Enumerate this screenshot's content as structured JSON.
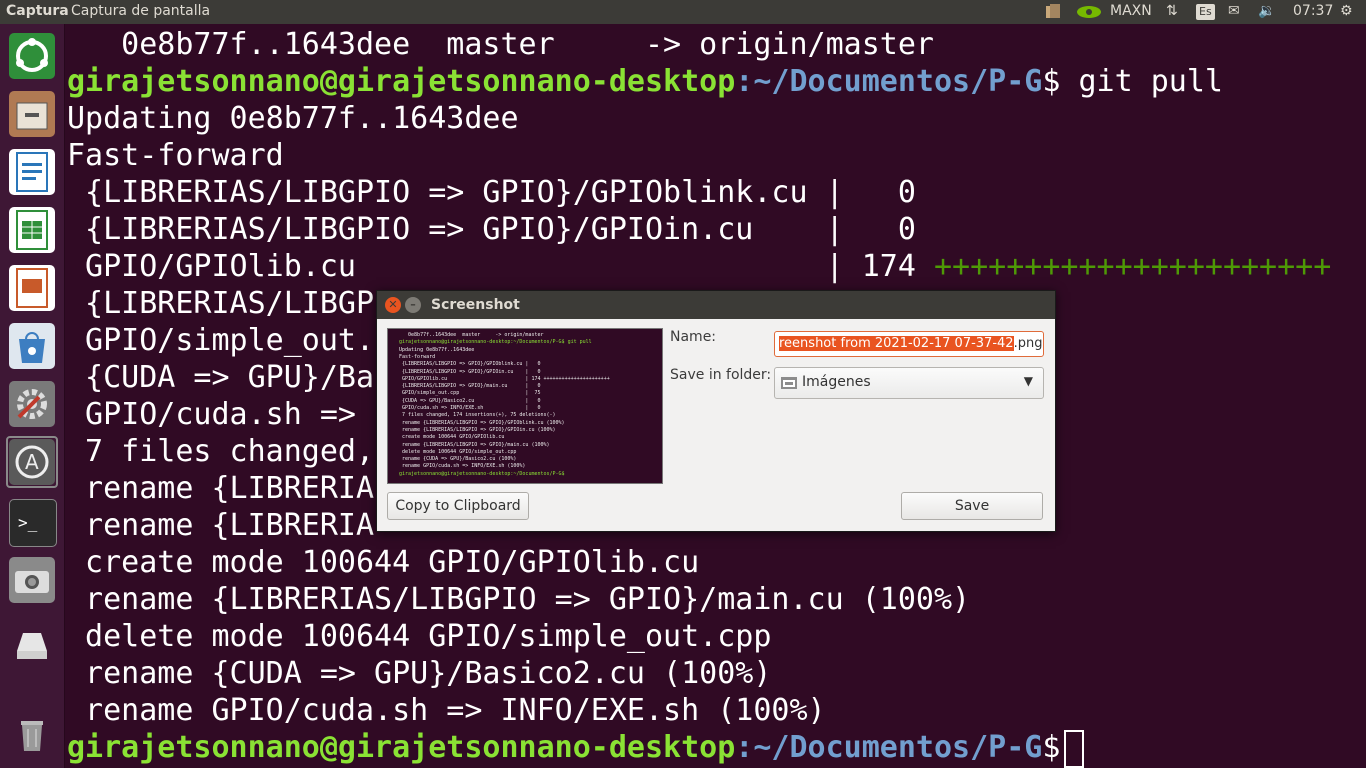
{
  "topbar": {
    "app_name": "Captura",
    "window_title": "Captura de pantalla",
    "nvidia_label": "MAXN",
    "keyboard_layout": "Es",
    "clock": "07:37",
    "icons": [
      "network-icon",
      "nvidia-icon",
      "transfer-icon",
      "keyboard-icon",
      "mail-icon",
      "volume-icon",
      "power-icon"
    ]
  },
  "launcher": {
    "items": [
      {
        "name": "ubuntu-dash-icon",
        "color": "#2f8f3a"
      },
      {
        "name": "files-icon",
        "color": "#b07a53"
      },
      {
        "name": "writer-icon",
        "color": "#2a76b9"
      },
      {
        "name": "calc-icon",
        "color": "#2f8f3a"
      },
      {
        "name": "impress-icon",
        "color": "#c85a2a"
      },
      {
        "name": "software-center-icon",
        "color": "#3d7ec1"
      },
      {
        "name": "system-settings-icon",
        "color": "#7a7a7a"
      },
      {
        "name": "software-updater-icon",
        "color": "#5a5a5a"
      },
      {
        "name": "terminal-icon",
        "color": "#2a2a2a"
      },
      {
        "name": "screenshot-icon",
        "color": "#8a8a8a"
      },
      {
        "name": "drive-icon",
        "color": "#cfcfcf"
      },
      {
        "name": "trash-icon",
        "color": "#9a9a9a"
      }
    ]
  },
  "terminal": {
    "prompt_user": "girajetsonnano@girajetsonnano-desktop",
    "prompt_path": ":~/Documentos/P-G",
    "command": "$ git pull",
    "prompt_end": "$",
    "line_top": "   0e8b77f..1643dee  master     -> origin/master",
    "line_updating": "Updating 0e8b77f..1643dee",
    "line_ff": "Fast-forward",
    "line_blink": " {LIBRERIAS/LIBGPIO => GPIO}/GPIOblink.cu |   0",
    "line_in": " {LIBRERIAS/LIBGPIO => GPIO}/GPIOin.cu    |   0",
    "line_lib": " GPIO/GPIOlib.cu                          | 174 ",
    "line_lib_plus": "++++++++++++++++++++++",
    "line_main_frag": " {LIBRERIAS/LIBGP",
    "line_simple_frag": " GPIO/simple_out.",
    "line_basico_frag": " {CUDA => GPU}/Ba",
    "line_cuda_frag": " GPIO/cuda.sh => ",
    "line_changed_frag": " 7 files changed,",
    "line_rename1_frag": " rename {LIBRERIA",
    "line_rename2_frag": " rename {LIBRERIA",
    "line_create": " create mode 100644 GPIO/GPIOlib.cu",
    "line_rename_main": " rename {LIBRERIAS/LIBGPIO => GPIO}/main.cu (100%)",
    "line_delete": " delete mode 100644 GPIO/simple_out.cpp",
    "line_rename_basico": " rename {CUDA => GPU}/Basico2.cu (100%)",
    "line_rename_cuda": " rename GPIO/cuda.sh => INFO/EXE.sh (100%)"
  },
  "dialog": {
    "title": "Screenshot",
    "name_label": "Name:",
    "name_value_selected": "reenshot from 2021-02-17 07-37-42",
    "name_value_ext": ".png",
    "folder_label": "Save in folder:",
    "folder_value": "Imágenes",
    "copy_button": "Copy to Clipboard",
    "save_button": "Save",
    "thumbnail_lines": [
      "   0e8b77f..1643dee  master     -> origin/master",
      "girajetsonnano@girajetsonnano-desktop:~/Documentos/P-G$ git pull",
      "Updating 0e8b77f..1643dee",
      "Fast-forward",
      " {LIBRERIAS/LIBGPIO => GPIO}/GPIOblink.cu |   0",
      " {LIBRERIAS/LIBGPIO => GPIO}/GPIOin.cu    |   0",
      " GPIO/GPIOlib.cu                          | 174 ++++++++++++++++++++++",
      " {LIBRERIAS/LIBGPIO => GPIO}/main.cu      |   0",
      " GPIO/simple_out.cpp                      |  75",
      " {CUDA => GPU}/Basico2.cu                 |   0",
      " GPIO/cuda.sh => INFO/EXE.sh              |   0",
      " 7 files changed, 174 insertions(+), 75 deletions(-)",
      " rename {LIBRERIAS/LIBGPIO => GPIO}/GPIOblink.cu (100%)",
      " rename {LIBRERIAS/LIBGPIO => GPIO}/GPIOin.cu (100%)",
      " create mode 100644 GPIO/GPIOlib.cu",
      " rename {LIBRERIAS/LIBGPIO => GPIO}/main.cu (100%)",
      " delete mode 100644 GPIO/simple_out.cpp",
      " rename {CUDA => GPU}/Basico2.cu (100%)",
      " rename GPIO/cuda.sh => INFO/EXE.sh (100%)",
      "girajetsonnano@girajetsonnano-desktop:~/Documentos/P-G$"
    ]
  },
  "colors": {
    "terminal_bg": "#300a24",
    "prompt_green": "#8ae234",
    "prompt_blue": "#729fcf",
    "diff_plus": "#4e9a06",
    "selection_orange": "#e95420",
    "panel": "#3c3b37"
  }
}
